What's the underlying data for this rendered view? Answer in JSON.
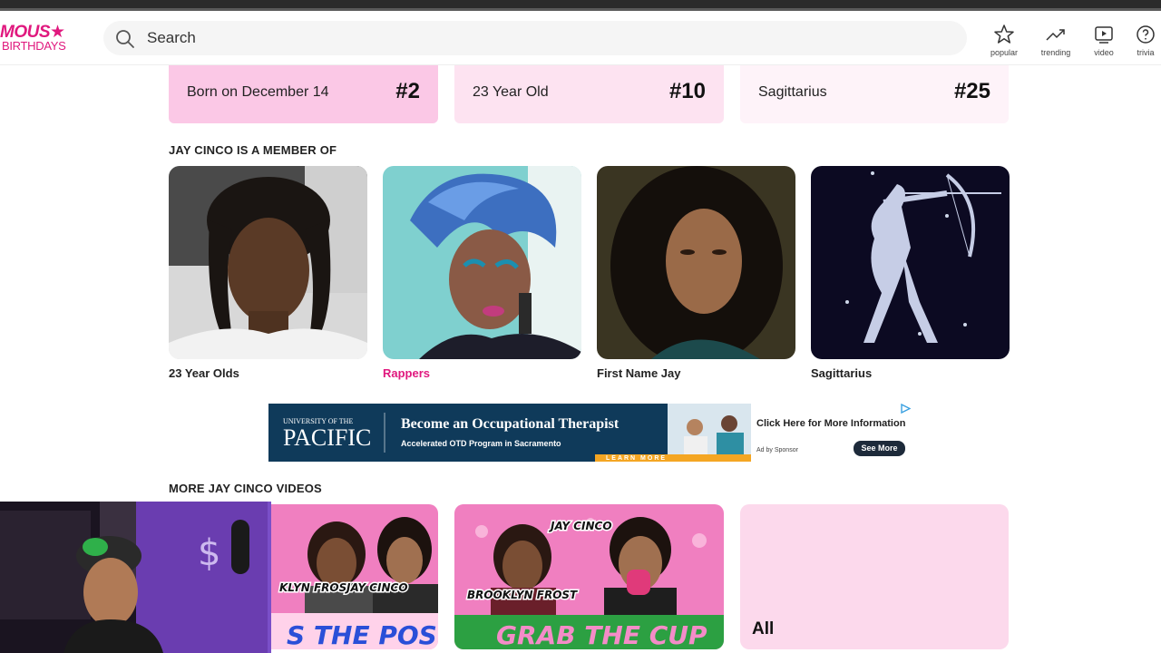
{
  "logo": {
    "line1": "MOUS",
    "line2": "BIRTHDAYS",
    "star": "★"
  },
  "search": {
    "placeholder": "Search",
    "icon": "search-icon"
  },
  "nav": [
    {
      "label": "popular",
      "icon": "star-icon"
    },
    {
      "label": "trending",
      "icon": "trending-icon"
    },
    {
      "label": "video",
      "icon": "video-icon"
    },
    {
      "label": "trivia",
      "icon": "question-icon"
    }
  ],
  "rankings": [
    {
      "label": "Born on December 14",
      "rank": "#2"
    },
    {
      "label": "23 Year Old",
      "rank": "#10"
    },
    {
      "label": "Sagittarius",
      "rank": "#25"
    }
  ],
  "member_section": {
    "title": "JAY CINCO IS A MEMBER OF",
    "groups": [
      {
        "label": "23 Year Olds"
      },
      {
        "label": "Rappers"
      },
      {
        "label": "First Name Jay"
      },
      {
        "label": "Sagittarius"
      }
    ]
  },
  "ad": {
    "school_line1": "UNIVERSITY OF THE",
    "school_line2": "PACIFIC",
    "headline": "Become an Occupational Therapist",
    "subline": "Accelerated OTD Program in Sacramento",
    "learn_more": "LEARN MORE",
    "cta": "Click Here for More Information",
    "by": "Ad by Sponsor",
    "button": "See More"
  },
  "videos_section": {
    "title": "MORE JAY CINCO VIDEOS",
    "videos": [
      {
        "caption": "S THE POST",
        "name_left": "KLYN FROST",
        "name_right": "JAY CINCO"
      },
      {
        "caption": "GRAB THE CUP",
        "name_top": "JAY CINCO",
        "name_left": "BROOKLYN FROST"
      },
      {
        "label": "All"
      }
    ]
  },
  "colors": {
    "brand": "#e0187e",
    "card_pink_1": "#fbc8e6",
    "card_pink_2": "#fde3f1",
    "card_pink_3": "#fef3f9"
  }
}
